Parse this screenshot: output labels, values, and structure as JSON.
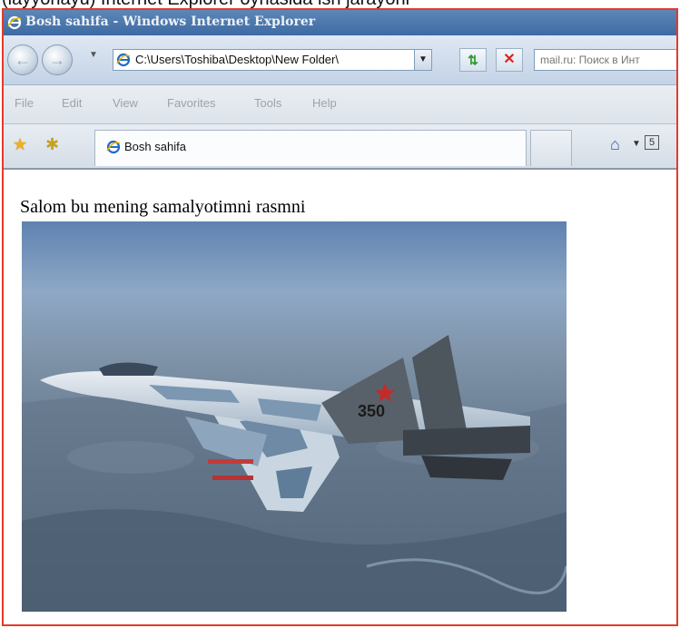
{
  "caption_above": "(layyonayu) Internet Explorer oynasida ish jarayoni",
  "window": {
    "title": "Bosh sahifa - Windows Internet Explorer"
  },
  "toolbar": {
    "address": "C:\\Users\\Toshiba\\Desktop\\New Folder\\",
    "search_placeholder": "mail.ru: Поиск в Инт"
  },
  "menu": {
    "items": [
      "File",
      "Edit",
      "View",
      "Favorites",
      "Tools",
      "Help"
    ]
  },
  "favorites_bar": {
    "tab_label": "Bosh sahifa",
    "feed_icon_text": "5"
  },
  "page": {
    "heading": "Salom bu mening samalyotimni rasmni",
    "image_alt": "Fighter jet in flight",
    "jet_number": "350"
  },
  "colors": {
    "window_border": "#e53a2a",
    "titlebar": "#4a77ad",
    "toolbar": "#d3dfec"
  }
}
